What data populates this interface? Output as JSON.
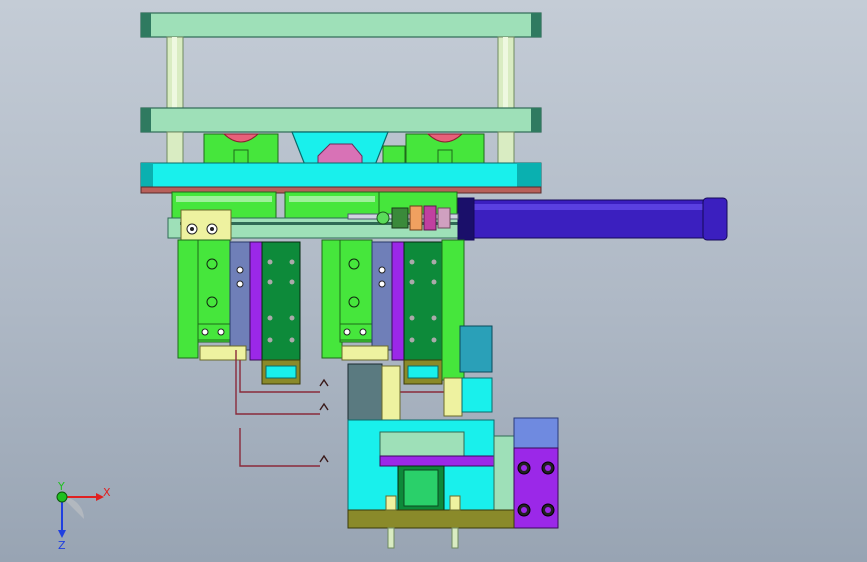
{
  "viewport": {
    "background_top": "#c4ccd6",
    "background_bottom": "#98a4b3"
  },
  "triad": {
    "x_label": "X",
    "y_label": "Y",
    "z_label": "Z",
    "x_color": "#e02020",
    "y_color": "#20c020",
    "z_color": "#2040e0"
  },
  "colors": {
    "plate_green": "#9ee0b8",
    "plate_edge": "#2f6a55",
    "rod": "#d9ecc2",
    "cyan": "#19f0ec",
    "lime": "#46e63c",
    "dark_green": "#0d8a3a",
    "purple": "#9b28e8",
    "cylinder_blue": "#3b1fbf",
    "pink": "#d872b6",
    "olive": "#8a8a2a",
    "teal": "#2aa0b8",
    "yellow": "#eef2a0",
    "slate": "#6f7fb8",
    "brown": "#b8605a"
  }
}
